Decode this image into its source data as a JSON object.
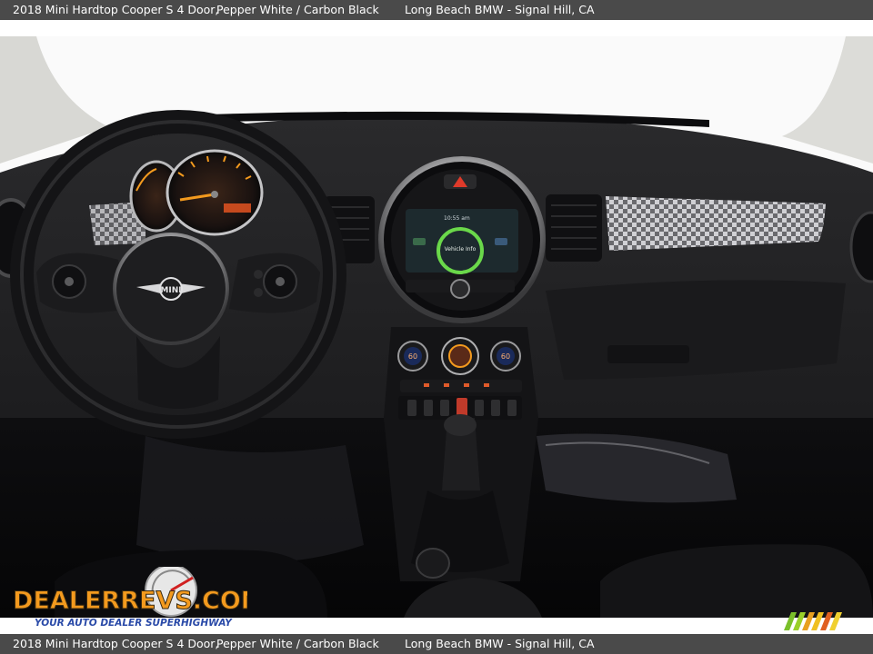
{
  "caption": {
    "vehicle": "2018 Mini Hardtop Cooper S 4 Door,",
    "colors": "Pepper White / Carbon Black",
    "dealer": "Long Beach BMW - Signal Hill, CA"
  },
  "photo": {
    "screen_label": "Vehicle Info",
    "screen_time": "10:55 am",
    "steering_badge": "MINI",
    "climate_left": "60",
    "climate_right": "60"
  },
  "watermark": {
    "brand": "DEALERREVS.COM",
    "tagline": "YOUR AUTO DEALER SUPERHIGHWAY"
  },
  "colors": {
    "bar": "#4a4a4a",
    "dash": "#1c1c1e",
    "accent_orange": "#f39a1e",
    "accent_blue": "#2a4aa8",
    "screen_green": "#6ad84a"
  }
}
